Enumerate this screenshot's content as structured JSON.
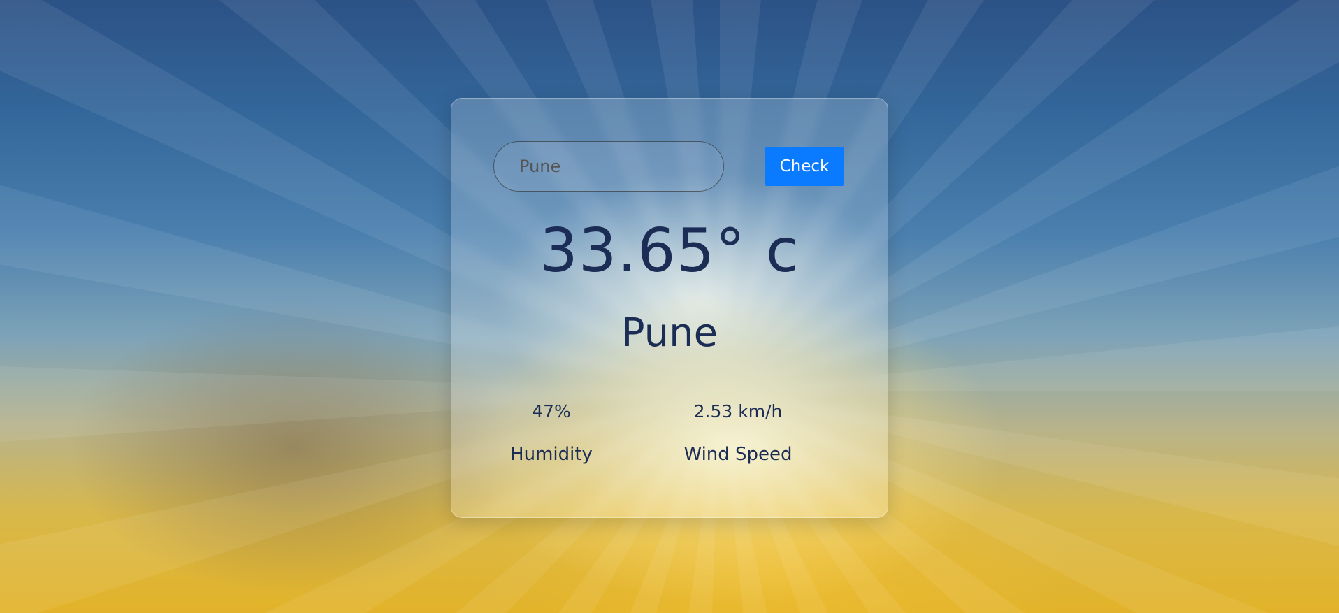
{
  "search": {
    "value": "Pune",
    "button_label": "Check"
  },
  "weather": {
    "temperature": "33.65° c",
    "city": "Pune",
    "humidity_value": "47%",
    "humidity_label": "Humidity",
    "wind_value": "2.53 km/h",
    "wind_label": "Wind Speed"
  },
  "colors": {
    "accent": "#0a7bff",
    "text": "#1b2d55"
  }
}
